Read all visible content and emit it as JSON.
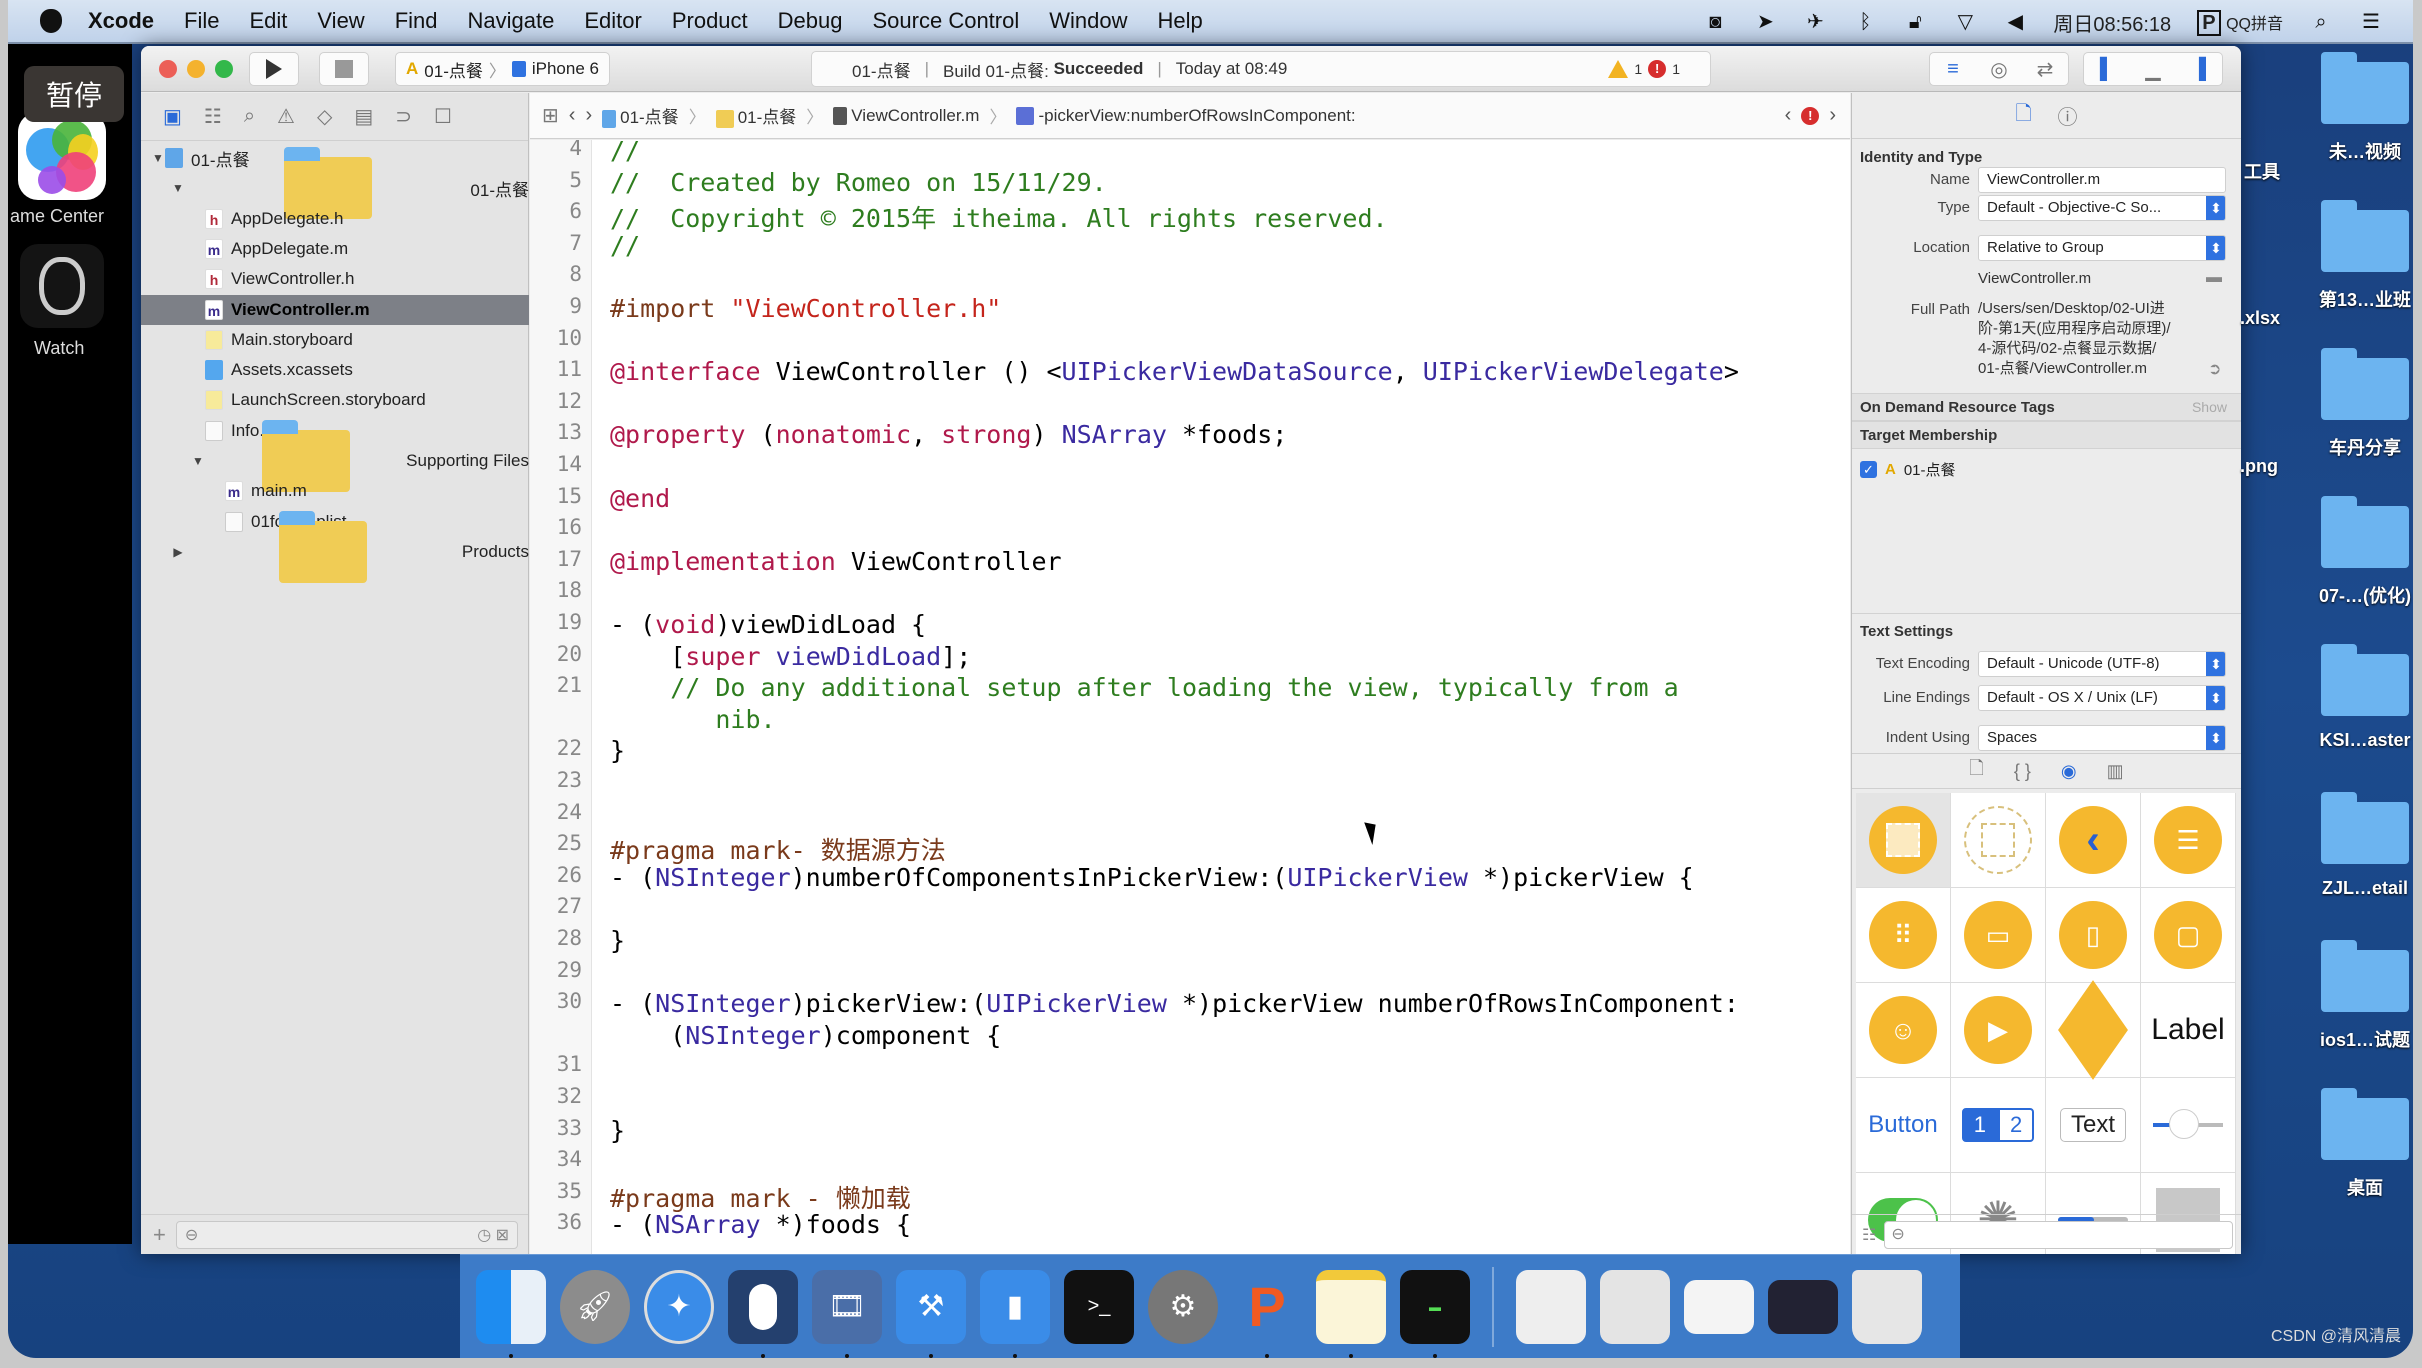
{
  "menubar": {
    "app": "Xcode",
    "items": [
      "File",
      "Edit",
      "View",
      "Find",
      "Navigate",
      "Editor",
      "Product",
      "Debug",
      "Source Control",
      "Window",
      "Help"
    ],
    "clock": "周日08:56:18",
    "input_method": "QQ拼音",
    "status_icons": [
      "screen-record-icon",
      "location-icon",
      "airplane-icon",
      "bluetooth-icon",
      "lock-icon",
      "wifi-icon",
      "volume-icon"
    ]
  },
  "overlay": {
    "pause_label": "暂停",
    "game_center_label": "ame Center",
    "watch_label": "Watch"
  },
  "toolbar": {
    "scheme": "01-点餐",
    "device": "iPhone 6",
    "activity": {
      "project": "01-点餐",
      "build_prefix": "Build 01-点餐:",
      "build_status": "Succeeded",
      "time": "Today at 08:49",
      "warnings": "1",
      "errors": "1"
    }
  },
  "navigator": {
    "tree": [
      {
        "label": "01-点餐",
        "depth": 0,
        "icon": "proj",
        "disclosure": "▼"
      },
      {
        "label": "01-点餐",
        "depth": 1,
        "icon": "folder",
        "disclosure": "▼"
      },
      {
        "label": "AppDelegate.h",
        "depth": 2,
        "icon": "h"
      },
      {
        "label": "AppDelegate.m",
        "depth": 2,
        "icon": "m"
      },
      {
        "label": "ViewController.h",
        "depth": 2,
        "icon": "h"
      },
      {
        "label": "ViewController.m",
        "depth": 2,
        "icon": "m",
        "selected": true
      },
      {
        "label": "Main.storyboard",
        "depth": 2,
        "icon": "sb"
      },
      {
        "label": "Assets.xcassets",
        "depth": 2,
        "icon": "assets"
      },
      {
        "label": "LaunchScreen.storyboard",
        "depth": 2,
        "icon": "sb"
      },
      {
        "label": "Info.plist",
        "depth": 2,
        "icon": "plist"
      },
      {
        "label": "Supporting Files",
        "depth": 2,
        "icon": "folder",
        "disclosure": "▼"
      },
      {
        "label": "main.m",
        "depth": 3,
        "icon": "m"
      },
      {
        "label": "01foods.plist",
        "depth": 3,
        "icon": "plist"
      },
      {
        "label": "Products",
        "depth": 1,
        "icon": "folder",
        "disclosure": "▶"
      }
    ]
  },
  "jumpbar": {
    "crumbs": [
      "01-点餐",
      "01-点餐",
      "ViewController.m",
      "-pickerView:numberOfRowsInComponent:"
    ]
  },
  "editor": {
    "lines": [
      {
        "n": "4",
        "t": "//",
        "c": "com"
      },
      {
        "n": "5",
        "t": "//  Created by Romeo on 15/11/29.",
        "c": "com"
      },
      {
        "n": "6",
        "t": "//  Copyright © 2015年 itheima. All rights reserved.",
        "c": "com"
      },
      {
        "n": "7",
        "t": "//",
        "c": "com"
      },
      {
        "n": "8",
        "t": "",
        "c": ""
      },
      {
        "n": "9",
        "t": "#import \"ViewController.h\"",
        "c": "import"
      },
      {
        "n": "10",
        "t": "",
        "c": ""
      },
      {
        "n": "11",
        "t": "@interface ViewController () <UIPickerViewDataSource, UIPickerViewDelegate>",
        "c": "interface"
      },
      {
        "n": "12",
        "t": "",
        "c": ""
      },
      {
        "n": "13",
        "t": "@property (nonatomic, strong) NSArray *foods;",
        "c": "property"
      },
      {
        "n": "14",
        "t": "",
        "c": ""
      },
      {
        "n": "15",
        "t": "@end",
        "c": "kw"
      },
      {
        "n": "16",
        "t": "",
        "c": ""
      },
      {
        "n": "17",
        "t": "@implementation ViewController",
        "c": "impl"
      },
      {
        "n": "18",
        "t": "",
        "c": ""
      },
      {
        "n": "19",
        "t": "- (void)viewDidLoad {",
        "c": "void"
      },
      {
        "n": "20",
        "t": "    [super viewDidLoad];",
        "c": "super"
      },
      {
        "n": "21",
        "t": "    // Do any additional setup after loading the view, typically from a",
        "c": "com"
      },
      {
        "n": "",
        "t": "       nib.",
        "c": "com"
      },
      {
        "n": "22",
        "t": "}",
        "c": ""
      },
      {
        "n": "23",
        "t": "",
        "c": ""
      },
      {
        "n": "24",
        "t": "",
        "c": ""
      },
      {
        "n": "25",
        "t": "#pragma mark- 数据源方法",
        "c": "pp"
      },
      {
        "n": "26",
        "t": "- (NSInteger)numberOfComponentsInPickerView:(UIPickerView *)pickerView {",
        "c": "method"
      },
      {
        "n": "27",
        "t": "",
        "c": ""
      },
      {
        "n": "28",
        "t": "}",
        "c": ""
      },
      {
        "n": "29",
        "t": "",
        "c": ""
      },
      {
        "n": "30",
        "t": "- (NSInteger)pickerView:(UIPickerView *)pickerView numberOfRowsInComponent:",
        "c": "method"
      },
      {
        "n": "",
        "t": "    (NSInteger)component {",
        "c": "method"
      },
      {
        "n": "31",
        "t": "",
        "c": ""
      },
      {
        "n": "32",
        "t": "",
        "c": ""
      },
      {
        "n": "33",
        "t": "}",
        "c": ""
      },
      {
        "n": "34",
        "t": "",
        "c": ""
      },
      {
        "n": "35",
        "t": "#pragma mark - 懒加载",
        "c": "pp"
      },
      {
        "n": "36",
        "t": "- (NSArray *)foods {",
        "c": "method"
      }
    ]
  },
  "inspector": {
    "identity_title": "Identity and Type",
    "name_label": "Name",
    "name_value": "ViewController.m",
    "type_label": "Type",
    "type_value": "Default - Objective-C So...",
    "location_label": "Location",
    "location_value": "Relative to Group",
    "location_file": "ViewController.m",
    "fullpath_label": "Full Path",
    "fullpath_lines": [
      "/Users/sen/Desktop/02-UI进",
      "阶-第1天(应用程序启动原理)/",
      "4-源代码/02-点餐显示数据/",
      "01-点餐/ViewController.m"
    ],
    "odr_title": "On Demand Resource Tags",
    "odr_show": "Show",
    "target_title": "Target Membership",
    "target_name": "01-点餐",
    "target_checked": true,
    "text_title": "Text Settings",
    "encoding_label": "Text Encoding",
    "encoding_value": "Default - Unicode (UTF-8)",
    "endings_label": "Line Endings",
    "endings_value": "Default - OS X / Unix (LF)",
    "indent_label": "Indent Using",
    "indent_value": "Spaces",
    "library": {
      "label_text": "Label",
      "button_text": "Button",
      "seg_1": "1",
      "seg_2": "2",
      "textfield_text": "Text"
    }
  },
  "desktop": {
    "items": [
      "未…视频",
      "第13…业班",
      "车丹分享",
      "07-…(优化)",
      "KSI…aster",
      "ZJL…etail",
      "ios1…试题",
      "桌面"
    ],
    "partial": [
      "工具",
      ".xlsx",
      ".png"
    ]
  },
  "dock": {
    "apps": [
      "finder",
      "launchpad",
      "safari",
      "mouse",
      "photo-booth",
      "xcode",
      "simulator",
      "terminal",
      "system-preferences",
      "wps",
      "notes",
      "activity-monitor"
    ],
    "docs": [
      "doc-1",
      "doc-2",
      "doc-3",
      "doc-4",
      "trash"
    ]
  },
  "watermark": "CSDN @清风清晨"
}
